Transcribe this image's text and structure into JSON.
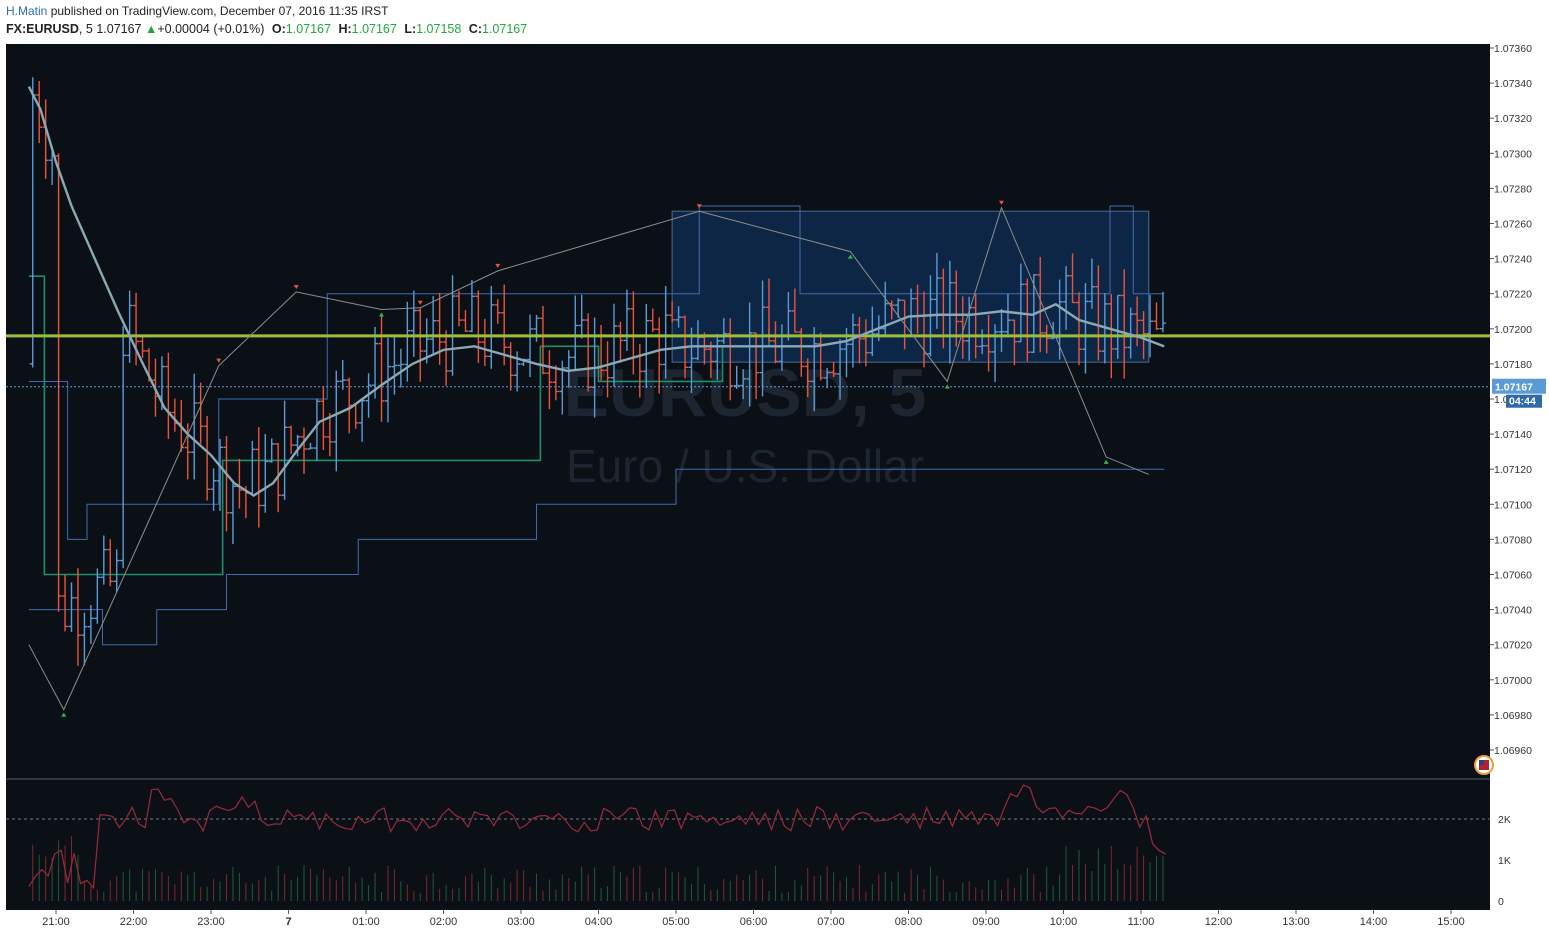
{
  "header": {
    "author": "H.Matin",
    "published_text": "published on TradingView.com, December 07, 2016 11:35 IRST",
    "symbol": "FX:EURUSD",
    "interval": ", 5",
    "last": "1.07167",
    "change": "+0.00004 (+0.01%)",
    "open_label": "O:",
    "open": "1.07167",
    "high_label": "H:",
    "high": "1.07167",
    "low_label": "L:",
    "low": "1.07158",
    "close_label": "C:",
    "close": "1.07167"
  },
  "watermark": {
    "symbol": "EURUSD, 5",
    "description": "Euro / U.S. Dollar"
  },
  "colors": {
    "background": "#0b1017",
    "up_bar": "#5b9bd5",
    "down_bar": "#e8553a",
    "resistance_line": "#9bbf3a",
    "moving_average": "#8aa9b5",
    "channel": "#3e6bb0",
    "step_line": "#1f8f6a",
    "zigzag": "#8e8e8e",
    "range_box": "#0f2a4e"
  },
  "chart_data": {
    "type": "line",
    "title": "EURUSD, 5",
    "subtitle": "Euro / U.S. Dollar",
    "x_unit": "hour",
    "x_ticks": [
      "21:00",
      "22:00",
      "23:00",
      "7",
      "01:00",
      "02:00",
      "03:00",
      "04:00",
      "05:00",
      "06:00",
      "07:00",
      "08:00",
      "09:00",
      "10:00",
      "11:00",
      "12:00",
      "13:00",
      "14:00",
      "15:00"
    ],
    "y_ticks": [
      "1.07360",
      "1.07340",
      "1.07320",
      "1.07300",
      "1.07280",
      "1.07260",
      "1.07240",
      "1.07220",
      "1.07200",
      "1.07180",
      "1.07160",
      "1.07140",
      "1.07120",
      "1.07100",
      "1.07080",
      "1.07060",
      "1.07040",
      "1.07020",
      "1.07000",
      "1.06980",
      "1.06960"
    ],
    "ylim": [
      1.0695,
      1.0736
    ],
    "xlim": [
      20.65,
      39.7
    ],
    "resistance_level": 1.07196,
    "last_price_label": "1.07167",
    "countdown_label": "04:44",
    "price_line": 1.07167,
    "range_box": {
      "x0": 28.95,
      "x1": 35.1,
      "y0": 1.07181,
      "y1": 1.07267
    },
    "series": [
      {
        "name": "Moving average",
        "x": [
          20.65,
          20.8,
          21.0,
          21.2,
          21.5,
          21.8,
          22.1,
          22.4,
          22.7,
          23.0,
          23.3,
          23.55,
          23.8,
          24.1,
          24.4,
          24.8,
          25.2,
          25.6,
          26.0,
          26.4,
          26.8,
          27.2,
          27.6,
          28.0,
          28.4,
          28.8,
          29.2,
          29.6,
          30.0,
          30.4,
          30.8,
          31.2,
          31.6,
          32.0,
          32.4,
          32.8,
          33.2,
          33.6,
          33.9,
          34.2,
          34.6,
          35.0,
          35.3
        ],
        "y": [
          1.07338,
          1.07325,
          1.07295,
          1.0727,
          1.0724,
          1.0721,
          1.07182,
          1.07155,
          1.0714,
          1.07128,
          1.07112,
          1.07105,
          1.07112,
          1.0713,
          1.07147,
          1.07155,
          1.07168,
          1.0718,
          1.07188,
          1.0719,
          1.07185,
          1.0718,
          1.07176,
          1.07178,
          1.07183,
          1.07188,
          1.0719,
          1.0719,
          1.0719,
          1.0719,
          1.0719,
          1.07193,
          1.072,
          1.07207,
          1.07208,
          1.07208,
          1.0721,
          1.07208,
          1.07214,
          1.07205,
          1.072,
          1.07195,
          1.0719
        ]
      },
      {
        "name": "Zigzag",
        "x": [
          20.65,
          21.1,
          23.1,
          24.1,
          25.2,
          25.7,
          26.7,
          29.3,
          31.25,
          32.5,
          33.2,
          34.55,
          35.1
        ],
        "y": [
          1.0702,
          1.06983,
          1.07179,
          1.07221,
          1.07211,
          1.07212,
          1.07233,
          1.07267,
          1.07244,
          1.0717,
          1.07269,
          1.07127,
          1.07117
        ]
      }
    ],
    "indicator_y_ticks": [
      "2K",
      "1K",
      "0"
    ]
  }
}
